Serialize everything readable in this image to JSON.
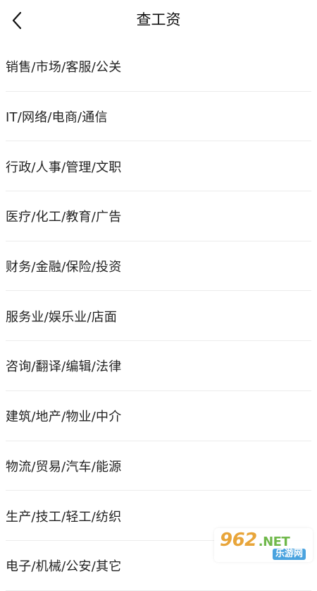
{
  "header": {
    "title": "查工资",
    "back_icon": "chevron-left-icon"
  },
  "categories": [
    "销售/市场/客服/公关",
    "IT/网络/电商/通信",
    "行政/人事/管理/文职",
    "医疗/化工/教育/广告",
    "财务/金融/保险/投资",
    "服务业/娱乐业/店面",
    "咨询/翻译/编辑/法律",
    "建筑/地产/物业/中介",
    "物流/贸易/汽车/能源",
    "生产/技工/轻工/纺织",
    "电子/机械/公安/其它"
  ],
  "watermark": {
    "main": "962",
    "net": ".NET",
    "sub": "乐游网"
  },
  "colors": {
    "divider": "#ececec",
    "text": "#222222",
    "watermark_orange": "#e8a53a",
    "watermark_green": "#6fb84a",
    "watermark_blue": "#4aa3df"
  }
}
